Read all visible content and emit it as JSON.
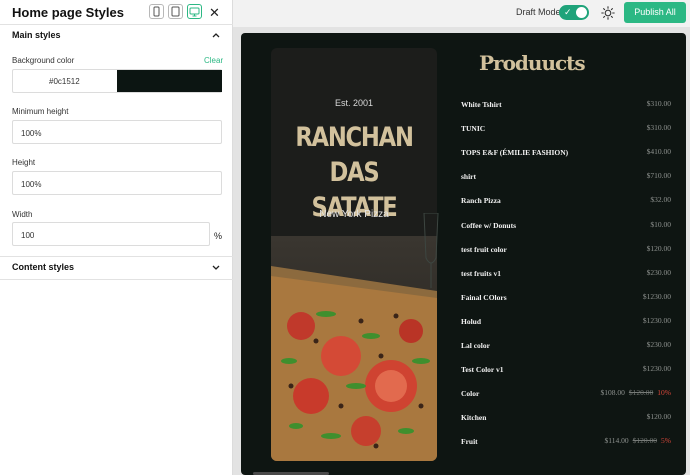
{
  "topbar": {
    "draft_label": "Draft Mode",
    "draft_on": true,
    "publish_label": "Publish All",
    "accent": "#2cb884"
  },
  "panel": {
    "title": "Home page Styles",
    "device_icons": [
      "mobile-icon",
      "tablet-icon",
      "desktop-icon"
    ],
    "main_styles_label": "Main styles",
    "background_color_label": "Background color",
    "clear_label": "Clear",
    "background_color_value": "#0c1512",
    "min_height_label": "Minimum height",
    "min_height_value": "100%",
    "height_label": "Height",
    "height_value": "100%",
    "width_label": "Width",
    "width_value": "100",
    "width_unit": "%",
    "content_styles_label": "Content styles"
  },
  "preview": {
    "background": "#0e1512",
    "hero": {
      "est": "Est. 2001",
      "brand": [
        "RANCHAN DAS",
        "SATATE"
      ],
      "city": "New York Pizza"
    },
    "products_title": "Produucts",
    "products": [
      {
        "name": "White Tshirt",
        "price": "$310.00"
      },
      {
        "name": "TUNIC",
        "price": "$310.00"
      },
      {
        "name": "TOPS E&F (ÉMILIE FASHION)",
        "price": "$410.00"
      },
      {
        "name": "shirt",
        "price": "$710.00"
      },
      {
        "name": "Ranch Pizza",
        "price": "$32.00"
      },
      {
        "name": "Coffee w/ Donuts",
        "price": "$10.00"
      },
      {
        "name": "test fruit color",
        "price": "$120.00"
      },
      {
        "name": "test fruits v1",
        "price": "$230.00"
      },
      {
        "name": "Fainal COlors",
        "price": "$1230.00"
      },
      {
        "name": "Holud",
        "price": "$1230.00"
      },
      {
        "name": "Lal color",
        "price": "$230.00"
      },
      {
        "name": "Test Color v1",
        "price": "$1230.00"
      },
      {
        "name": "Color",
        "price": "$108.00",
        "old": "$120.00",
        "discount": "10%"
      },
      {
        "name": "Kitchen",
        "price": "$120.00"
      },
      {
        "name": "Fruit",
        "price": "$114.00",
        "old": "$120.00",
        "discount": "5%"
      }
    ]
  }
}
